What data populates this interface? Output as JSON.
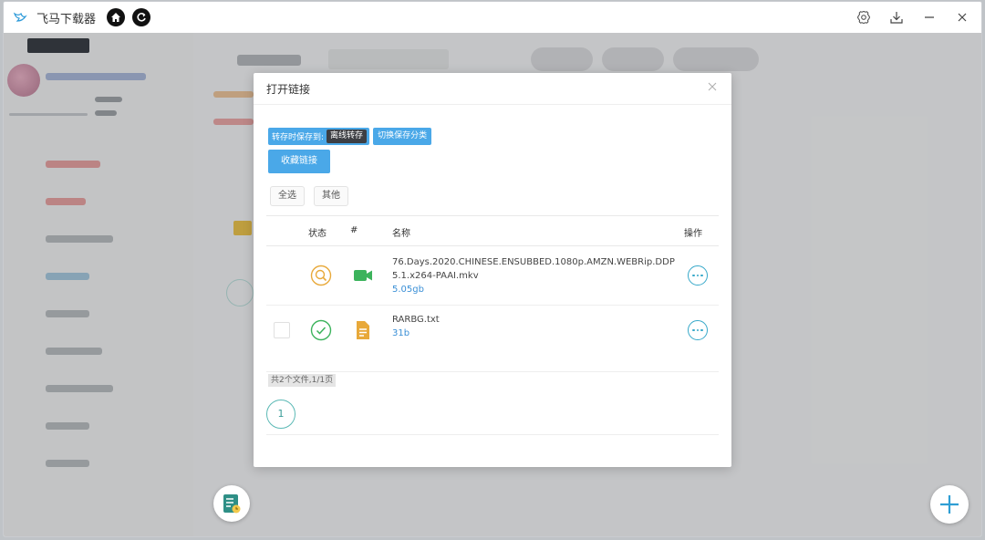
{
  "window": {
    "title": "飞马下载器"
  },
  "dialog": {
    "title": "打开链接",
    "save_label": "转存时保存到:",
    "save_target": "离线转存",
    "switch_label": "切换保存分类",
    "collect_label": "收藏链接",
    "filter_all": "全选",
    "filter_other": "其他",
    "columns": {
      "status": "状态",
      "index": "#",
      "name": "名称",
      "action": "操作"
    },
    "files": [
      {
        "name": "76.Days.2020.CHINESE.ENSUBBED.1080p.AMZN.WEBRip.DDP5.1.x264-PAAI.mkv",
        "size": "5.05gb",
        "status_icon": "search-icon",
        "type_icon": "video-icon"
      },
      {
        "name": "RARBG.txt",
        "size": "31b",
        "status_icon": "check-circle-icon",
        "type_icon": "text-file-icon"
      }
    ],
    "summary": "共2个文件,1/1页",
    "page": "1"
  },
  "colors": {
    "accent": "#4aa8e8",
    "teal": "#36a8c9",
    "orange": "#e8a93a",
    "green": "#3cb35c"
  }
}
